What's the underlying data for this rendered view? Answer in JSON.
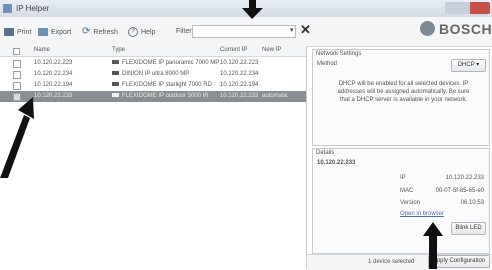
{
  "window": {
    "title": "IP Helper"
  },
  "toolbar": {
    "print": "Print",
    "export": "Export",
    "refresh": "Refresh",
    "help": "Help",
    "filter_label": "Filter",
    "filter_value": ""
  },
  "brand": {
    "name": "BOSCH"
  },
  "table": {
    "headers": [
      "Name",
      "Type",
      "Current IP",
      "New IP"
    ],
    "rows": [
      {
        "name": "10.120.22.223",
        "type": "FLEXIDOME IP panoramic 7000 MP",
        "current_ip": "10.120.22.223",
        "new_ip": "",
        "selected": false
      },
      {
        "name": "10.120.22.234",
        "type": "DINION IP ultra 8000 MP",
        "current_ip": "10.120.22.234",
        "new_ip": "",
        "selected": false
      },
      {
        "name": "10.120.22.194",
        "type": "FLEXIDOME IP starlight 7000 RD",
        "current_ip": "10.120.22.194",
        "new_ip": "",
        "selected": false
      },
      {
        "name": "10.120.22.233",
        "type": "FLEXIDOME IP outdoor 5000 IR",
        "current_ip": "10.120.22.233",
        "new_ip": "automatic",
        "selected": true
      }
    ]
  },
  "network_settings": {
    "title": "Network Settings",
    "method_label": "Method",
    "method_value": "DHCP",
    "info": "DHCP will be enabled for all selected devices. IP addresses will be assigned automatically. Be sure that a DHCP server is available in your network."
  },
  "details": {
    "title": "Details",
    "device": "10.120.22.233",
    "ip_label": "IP",
    "ip_value": "10.120.22.233",
    "mac_label": "MAC",
    "mac_value": "00-07-5f-85-65-e0",
    "version_label": "Version",
    "version_value": "06.10.53",
    "open_link": "Open in browser",
    "blink_button": "Blink LED"
  },
  "status": {
    "selection": "1 device selected",
    "apply_button": "Apply Configuration"
  },
  "colors": {
    "selected_row": "#8a8d92",
    "link": "#4a6fa5"
  }
}
